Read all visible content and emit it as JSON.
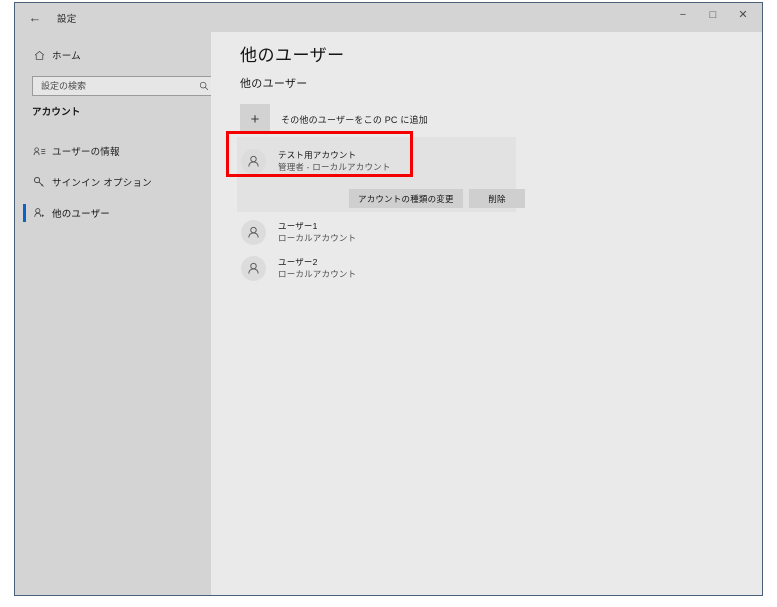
{
  "window": {
    "title": "設定",
    "back_icon": "←",
    "controls": {
      "minimize": "−",
      "maximize": "□",
      "close": "✕"
    }
  },
  "sidebar": {
    "home": {
      "label": "ホーム",
      "icon": "home-icon"
    },
    "search": {
      "placeholder": "設定の検索",
      "value": "",
      "icon": "search-icon"
    },
    "category": "アカウント",
    "items": [
      {
        "label": "ユーザーの情報",
        "icon": "user-info-icon",
        "selected": false
      },
      {
        "label": "サインイン オプション",
        "icon": "key-icon",
        "selected": false
      },
      {
        "label": "他のユーザー",
        "icon": "person-add-icon",
        "selected": true
      }
    ]
  },
  "main": {
    "page_title": "他のユーザー",
    "section_title": "他のユーザー",
    "add_user": {
      "label": "その他のユーザーをこの PC に追加",
      "icon": "plus-icon"
    },
    "selected_account": {
      "name": "テスト用アカウント",
      "detail": "管理者 - ローカルアカウント",
      "icon": "person-icon"
    },
    "actions": [
      {
        "label": "アカウントの種類の変更"
      },
      {
        "label": "削除"
      }
    ],
    "accounts": [
      {
        "name": "ユーザー1",
        "detail": "ローカルアカウント",
        "icon": "person-icon"
      },
      {
        "name": "ユーザー2",
        "detail": "ローカルアカウント",
        "icon": "person-icon"
      }
    ]
  },
  "annotation": {
    "highlight_color": "#f40000"
  },
  "colors": {
    "accent": "#0a63c9",
    "titlebar_bg": "#d4d4d4",
    "sidebar_bg": "#d4d4d4",
    "content_bg": "#eaeaea",
    "card_bg": "#e2e2e2",
    "button_bg": "#cfcfcf"
  }
}
